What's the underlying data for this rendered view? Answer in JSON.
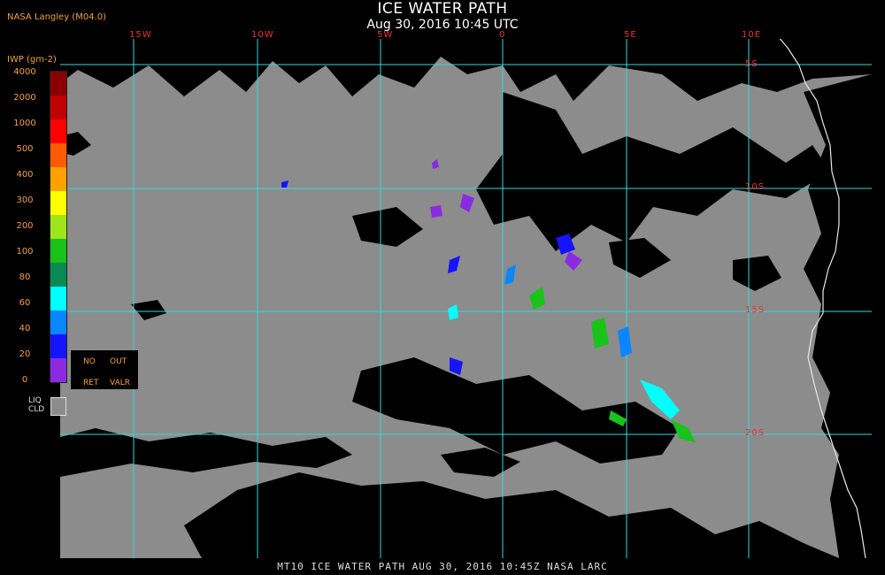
{
  "header": {
    "title": "ICE WATER PATH",
    "subtitle": "Aug 30, 2016 10:45 UTC",
    "org": "NASA Langley (M04.0)"
  },
  "map": {
    "lon_labels": [
      "15W",
      "10W",
      "5W",
      "0",
      "5E",
      "10E"
    ],
    "lat_labels": [
      "5S",
      "10S",
      "15S",
      "20S"
    ],
    "colors": {
      "background": "#8c8c8c",
      "clear": "#000000",
      "grid": "#35d8e0",
      "coast": "#e8e8e8"
    }
  },
  "legend": {
    "title": "IWP (gm-2)",
    "ticks": [
      "4000",
      "2000",
      "1000",
      "500",
      "400",
      "300",
      "200",
      "100",
      "80",
      "60",
      "40",
      "20",
      "0"
    ],
    "colors": [
      "#8a0000",
      "#c10000",
      "#ff0000",
      "#ff5a00",
      "#ffa200",
      "#ffff00",
      "#9ee61a",
      "#19c319",
      "#0a8a52",
      "#00ffff",
      "#0a86ff",
      "#1414ff",
      "#8a2be2"
    ],
    "no_ret": {
      "line1": "NO",
      "line2": "RET"
    },
    "out_valr": {
      "line1": "OUT",
      "line2": "VALR"
    },
    "liq_cld": {
      "line1": "LIQ",
      "line2": "CLD"
    }
  },
  "footer": {
    "text": "MT10   ICE WATER PATH    AUG 30, 2016 10:45Z    NASA LARC"
  }
}
